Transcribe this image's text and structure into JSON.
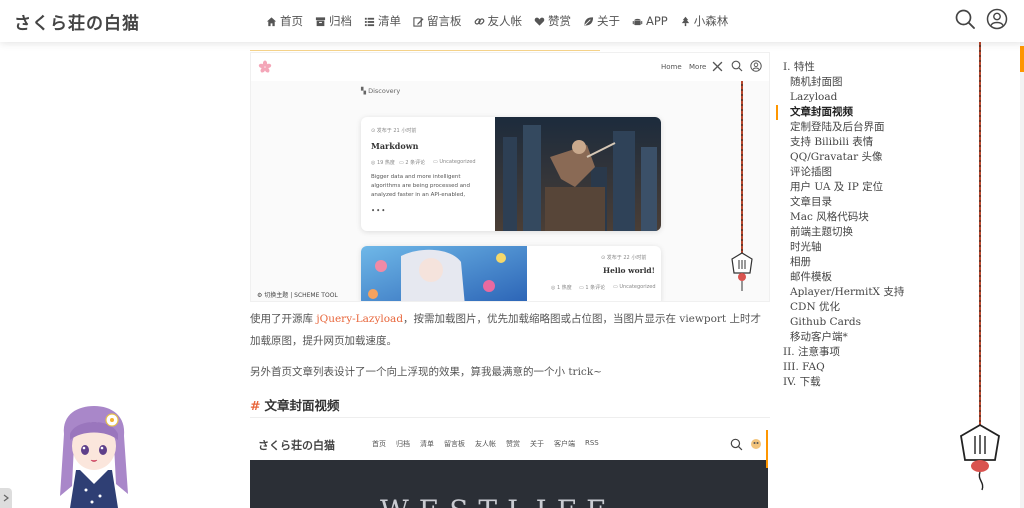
{
  "site": {
    "logo": "さくら荘の白猫"
  },
  "nav": {
    "items": [
      {
        "label": "首页",
        "icon": "home-icon"
      },
      {
        "label": "归档",
        "icon": "archive-icon"
      },
      {
        "label": "清单",
        "icon": "list-icon"
      },
      {
        "label": "留言板",
        "icon": "edit-icon"
      },
      {
        "label": "友人帐",
        "icon": "link-icon"
      },
      {
        "label": "赞赏",
        "icon": "heart-icon"
      },
      {
        "label": "关于",
        "icon": "leaf-icon"
      },
      {
        "label": "APP",
        "icon": "android-icon"
      },
      {
        "label": "小森林",
        "icon": "tree-icon"
      }
    ]
  },
  "header_icons": [
    "search-icon",
    "user-icon"
  ],
  "colors": {
    "accent": "#fe9600",
    "link": "#e8663b",
    "rope": "#b9482f"
  },
  "screenshot1": {
    "nav_home": "Home",
    "nav_more": "More",
    "discovery": "Discovery",
    "card1": {
      "date": "发布于 21 小时前",
      "title": "Markdown",
      "views": "19 热度",
      "comments": "2 条评论",
      "category": "Uncategorized",
      "excerpt": "Bigger data and more intelligent algorithms are being processed and analyzed faster in an API-enabled,",
      "more": "•••"
    },
    "card2": {
      "date": "发布于 22 小时前",
      "title": "Hello world!",
      "views": "1 热度",
      "comments": "1 条评论",
      "category": "Uncategorized"
    },
    "scheme_tool": "切换主题 | SCHEME TOOL"
  },
  "article": {
    "p1_pre": "使用了开源库 ",
    "p1_link": "jQuery-Lazyload",
    "p1_post": "，按需加载图片，优先加载缩略图或占位图，当图片显示在 viewport 上时才加载原图，提升网页加载速度。",
    "p2": "另外首页文章列表设计了一个向上浮现的效果，算我最满意的一个小 trick~",
    "section_hash": "#",
    "section_title": "文章封面视频"
  },
  "screenshot2": {
    "logo": "さくら荘の白猫",
    "nav": [
      "首页",
      "归档",
      "清单",
      "留言板",
      "友人帐",
      "赞赏",
      "关于",
      "客户端",
      "RSS"
    ],
    "banner_text": "WESTLIFE"
  },
  "toc": [
    {
      "label": "I. 特性",
      "level": 1
    },
    {
      "label": "随机封面图",
      "level": 2
    },
    {
      "label": "Lazyload",
      "level": 2
    },
    {
      "label": "文章封面视频",
      "level": 2,
      "active": true
    },
    {
      "label": "定制登陆及后台界面",
      "level": 2
    },
    {
      "label": "支持 Bilibili 表情",
      "level": 2
    },
    {
      "label": "QQ/Gravatar 头像",
      "level": 2
    },
    {
      "label": "评论插图",
      "level": 2
    },
    {
      "label": "用户 UA 及 IP 定位",
      "level": 2
    },
    {
      "label": "文章目录",
      "level": 2
    },
    {
      "label": "Mac 风格代码块",
      "level": 2
    },
    {
      "label": "前端主题切换",
      "level": 2
    },
    {
      "label": "时光轴",
      "level": 2
    },
    {
      "label": "相册",
      "level": 2
    },
    {
      "label": "邮件模板",
      "level": 2
    },
    {
      "label": "Aplayer/HermitX 支持",
      "level": 2
    },
    {
      "label": "CDN 优化",
      "level": 2
    },
    {
      "label": "Github Cards",
      "level": 2
    },
    {
      "label": "移动客户端*",
      "level": 2
    },
    {
      "label": "II. 注意事项",
      "level": 1
    },
    {
      "label": "III. FAQ",
      "level": 1
    },
    {
      "label": "IV. 下载",
      "level": 1
    }
  ]
}
